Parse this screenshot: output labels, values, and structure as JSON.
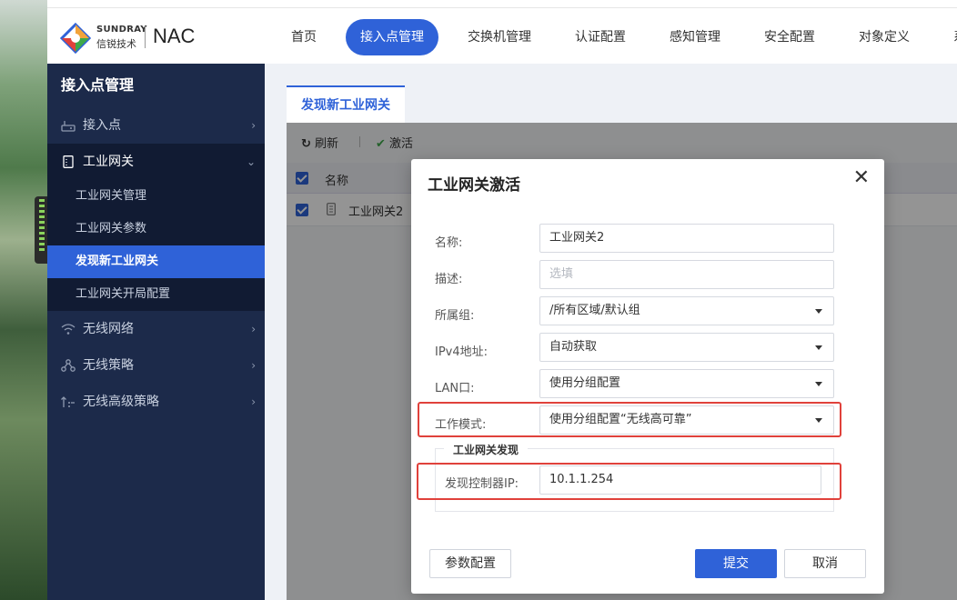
{
  "brand": {
    "name_en": "SUNDRAY",
    "name_cn": "信锐技术",
    "product": "NAC",
    "colors": {
      "primary": "#2f62d8",
      "sidebar": "#1c2a4a",
      "highlight": "#e0413b"
    }
  },
  "nav": {
    "items": [
      {
        "label": "首页"
      },
      {
        "label": "接入点管理",
        "active": true
      },
      {
        "label": "交换机管理"
      },
      {
        "label": "认证配置"
      },
      {
        "label": "感知管理"
      },
      {
        "label": "安全配置"
      },
      {
        "label": "对象定义"
      },
      {
        "label": "系统管理"
      }
    ]
  },
  "sidebar": {
    "title": "接入点管理",
    "items": [
      {
        "label": "接入点",
        "icon": "router-icon"
      },
      {
        "label": "工业网关",
        "icon": "gateway-icon",
        "expanded": true,
        "children": [
          {
            "label": "工业网关管理"
          },
          {
            "label": "工业网关参数"
          },
          {
            "label": "发现新工业网关",
            "active": true
          },
          {
            "label": "工业网关开局配置"
          }
        ]
      },
      {
        "label": "无线网络",
        "icon": "wifi-icon"
      },
      {
        "label": "无线策略",
        "icon": "policy-icon"
      },
      {
        "label": "无线高级策略",
        "icon": "advanced-policy-icon"
      }
    ]
  },
  "tabs": [
    {
      "label": "发现新工业网关",
      "active": true
    }
  ],
  "toolbar": {
    "refresh": "刷新",
    "activate": "激活"
  },
  "table": {
    "columns": [
      "名称"
    ],
    "rows": [
      {
        "name": "工业网关2",
        "checked": true
      }
    ]
  },
  "modal": {
    "title": "工业网关激活",
    "fields": {
      "name": {
        "label": "名称:",
        "value": "工业网关2"
      },
      "desc": {
        "label": "描述:",
        "placeholder": "选填"
      },
      "group": {
        "label": "所属组:",
        "value": "/所有区域/默认组"
      },
      "ipv4": {
        "label": "IPv4地址:",
        "value": "自动获取"
      },
      "lan": {
        "label": "LAN口:",
        "value": "使用分组配置"
      },
      "mode": {
        "label": "工作模式:",
        "value": "使用分组配置“无线高可靠”"
      }
    },
    "discovery": {
      "legend": "工业网关发现",
      "controller_ip_label": "发现控制器IP:",
      "controller_ip_value": "10.1.1.254"
    },
    "buttons": {
      "params": "参数配置",
      "submit": "提交",
      "cancel": "取消"
    }
  }
}
